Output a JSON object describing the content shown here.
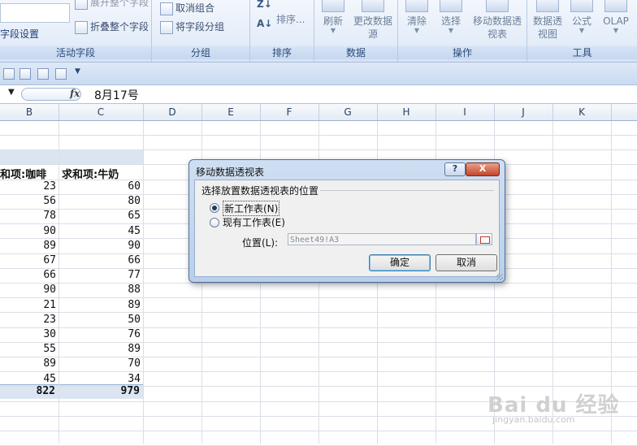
{
  "ribbon": {
    "groups": [
      {
        "label": "活动字段",
        "items": [
          "字段设置",
          "展开整个字段",
          "折叠整个字段"
        ]
      },
      {
        "label": "分组",
        "items": [
          "取消组合",
          "将字段分组"
        ]
      },
      {
        "label": "排序",
        "items": [
          "排序..."
        ]
      },
      {
        "label": "数据",
        "items": [
          "刷新",
          "更改数据源"
        ]
      },
      {
        "label": "操作",
        "items": [
          "清除",
          "选择",
          "移动数据透视表"
        ]
      },
      {
        "label": "工具",
        "items": [
          "数据透视图",
          "公式",
          "OLAP"
        ]
      }
    ]
  },
  "formula_bar": {
    "fx": "fx",
    "value": "8月17号"
  },
  "columns": [
    "B",
    "C",
    "D",
    "E",
    "F",
    "G",
    "H",
    "I",
    "J",
    "K"
  ],
  "pivot": {
    "header_b": "和项:咖啡",
    "header_c": "求和项:牛奶",
    "rows": [
      {
        "b": 23,
        "c": 60
      },
      {
        "b": 56,
        "c": 80
      },
      {
        "b": 78,
        "c": 65
      },
      {
        "b": 90,
        "c": 45
      },
      {
        "b": 89,
        "c": 90
      },
      {
        "b": 67,
        "c": 66
      },
      {
        "b": 66,
        "c": 77
      },
      {
        "b": 90,
        "c": 88
      },
      {
        "b": 21,
        "c": 89
      },
      {
        "b": 23,
        "c": 50
      },
      {
        "b": 30,
        "c": 76
      },
      {
        "b": 55,
        "c": 89
      },
      {
        "b": 89,
        "c": 70
      },
      {
        "b": 45,
        "c": 34
      }
    ],
    "total_b": 822,
    "total_c": 979
  },
  "dialog": {
    "title": "移动数据透视表",
    "help": "?",
    "close": "X",
    "legend": "选择放置数据透视表的位置",
    "option_new": "新工作表(N)",
    "option_existing": "现有工作表(E)",
    "selected": "new",
    "location_label": "位置(L):",
    "location_value": "Sheet49!A3",
    "ok": "确定",
    "cancel": "取消"
  },
  "watermark": {
    "text": "Bai du 经验",
    "sub": "jingyan.baidu.com"
  }
}
